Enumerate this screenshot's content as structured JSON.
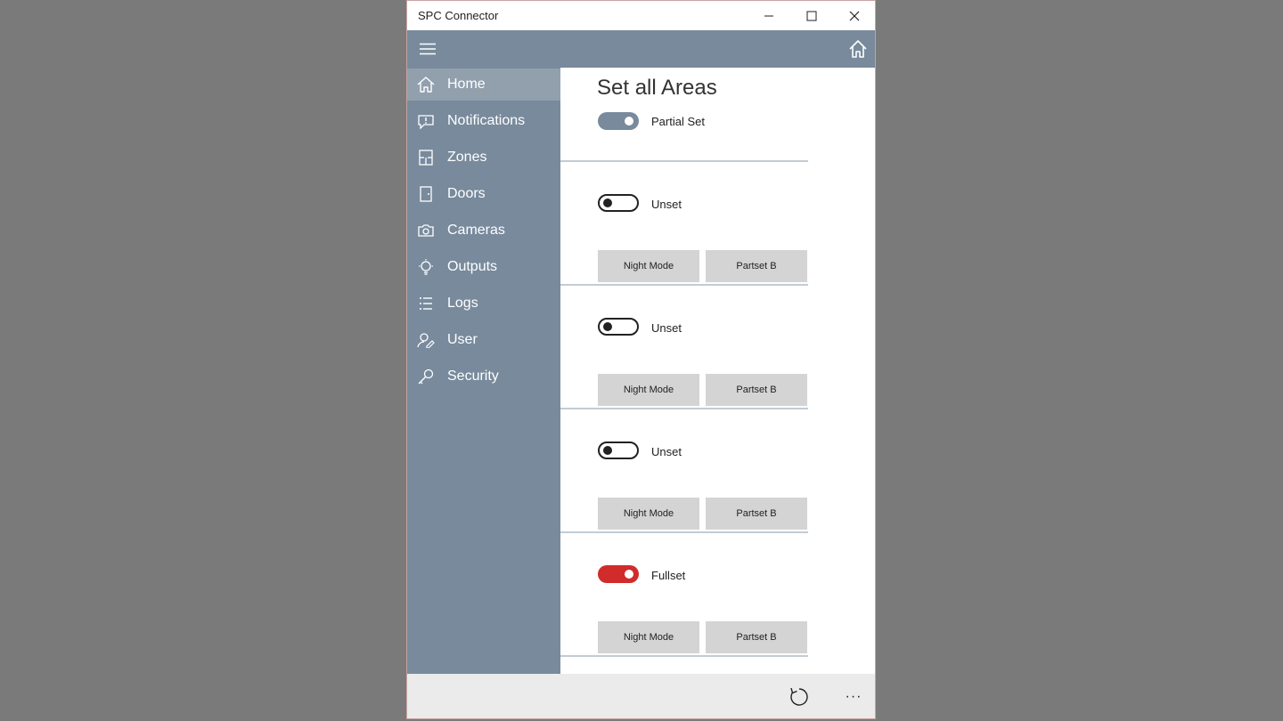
{
  "window": {
    "title": "SPC Connector"
  },
  "nav": {
    "items": [
      {
        "label": "Home",
        "icon": "home-icon",
        "active": true
      },
      {
        "label": "Notifications",
        "icon": "notifications-icon"
      },
      {
        "label": "Zones",
        "icon": "zones-icon"
      },
      {
        "label": "Doors",
        "icon": "door-icon"
      },
      {
        "label": "Cameras",
        "icon": "camera-icon"
      },
      {
        "label": "Outputs",
        "icon": "lightbulb-icon"
      },
      {
        "label": "Logs",
        "icon": "list-icon"
      },
      {
        "label": "User",
        "icon": "user-icon"
      },
      {
        "label": "Security",
        "icon": "key-icon"
      }
    ]
  },
  "main": {
    "title": "Set all Areas",
    "all_areas": {
      "state": "Partial Set",
      "on": true
    },
    "areas": [
      {
        "state": "Unset",
        "on": false,
        "buttons": [
          "Night Mode",
          "Partset B"
        ]
      },
      {
        "state": "Unset",
        "on": false,
        "buttons": [
          "Night Mode",
          "Partset B"
        ]
      },
      {
        "state": "Unset",
        "on": false,
        "buttons": [
          "Night Mode",
          "Partset B"
        ]
      },
      {
        "state": "Fullset",
        "on": true,
        "buttons": [
          "Night Mode",
          "Partset B"
        ]
      }
    ]
  },
  "bottom": {
    "more_label": "···"
  },
  "colors": {
    "accent": "#788a9c",
    "nav_active": "#92a0ae",
    "fullset": "#d22b2b",
    "desktop": "#7a7a7a"
  }
}
